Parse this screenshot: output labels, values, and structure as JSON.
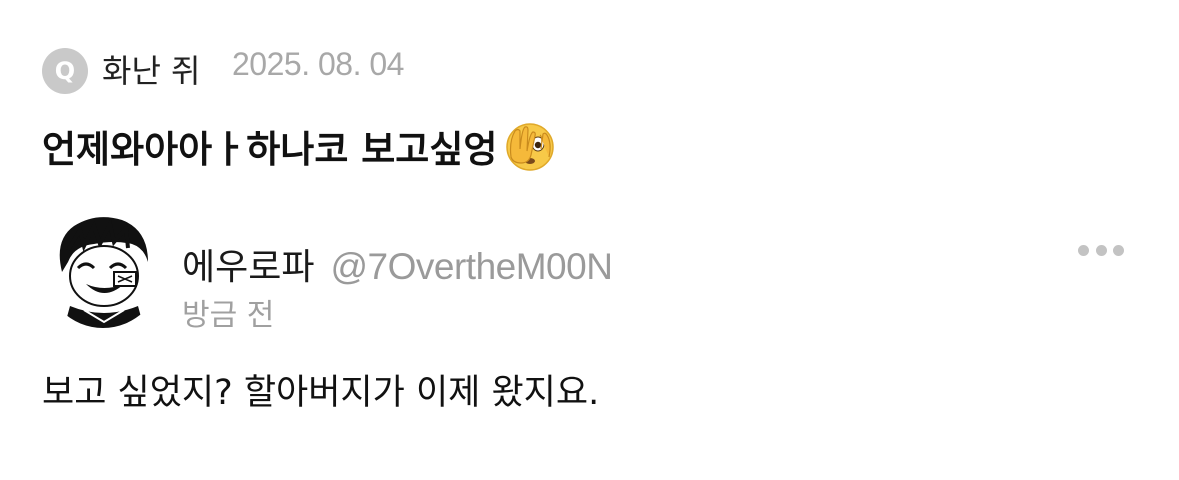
{
  "question": {
    "badge": "Q",
    "asker": "화난 쥐",
    "date": "2025. 08. 04",
    "text": "언제와아아ㅏ하나코 보고싶엉",
    "emoji": "face-with-peeking-eye-icon"
  },
  "reply": {
    "author_name": "에우로파",
    "handle": "@7OvertheM00N",
    "time": "방금 전",
    "text": "보고 싶었지? 할아버지가 이제 왔지요.",
    "more_icon": "more-horizontal-icon"
  },
  "colors": {
    "badge_bg": "#c9c9c9",
    "muted_text": "#a0a0a0",
    "emoji_yellow": "#f7c948"
  }
}
